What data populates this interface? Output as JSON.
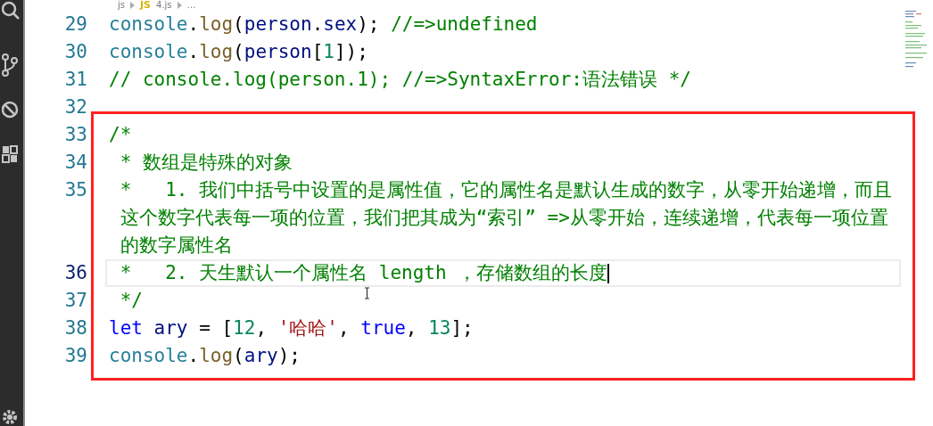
{
  "breadcrumb": {
    "folder": "js",
    "file_badge": "JS",
    "file": "4.js",
    "more": "…"
  },
  "lines": [
    {
      "number": "29",
      "current": false,
      "tokens": [
        {
          "kind": "obj",
          "text": "console"
        },
        {
          "kind": "plain",
          "text": "."
        },
        {
          "kind": "fn",
          "text": "log"
        },
        {
          "kind": "plain",
          "text": "("
        },
        {
          "kind": "var",
          "text": "person"
        },
        {
          "kind": "plain",
          "text": "."
        },
        {
          "kind": "var",
          "text": "sex"
        },
        {
          "kind": "plain",
          "text": "); "
        },
        {
          "kind": "comment",
          "text": "//=>undefined"
        }
      ]
    },
    {
      "number": "30",
      "current": false,
      "tokens": [
        {
          "kind": "obj",
          "text": "console"
        },
        {
          "kind": "plain",
          "text": "."
        },
        {
          "kind": "fn",
          "text": "log"
        },
        {
          "kind": "plain",
          "text": "("
        },
        {
          "kind": "var",
          "text": "person"
        },
        {
          "kind": "plain",
          "text": "["
        },
        {
          "kind": "num",
          "text": "1"
        },
        {
          "kind": "plain",
          "text": "]);"
        }
      ]
    },
    {
      "number": "31",
      "current": false,
      "tokens": [
        {
          "kind": "comment",
          "text": "// console.log(person.1); //=>SyntaxError:语法错误 */"
        }
      ]
    },
    {
      "number": "32",
      "current": false
    }
  ],
  "annotation": {
    "color": "#ff2020",
    "lines": [
      {
        "number": "33",
        "current": false,
        "tokens": [
          {
            "kind": "comment",
            "text": "/*"
          }
        ]
      },
      {
        "number": "34",
        "current": false,
        "tokens": [
          {
            "kind": "comment",
            "text": " * 数组是特殊的对象"
          }
        ]
      },
      {
        "number": "35",
        "current": false,
        "tokens": [
          {
            "kind": "comment",
            "text": " *   1. 我们中括号中设置的是属性值，它的属性名是默认生成的数字，从零开始递增，而且这个数字代表每一项的位置，我们把其成为“索引” =>从零开始，连续递增，代表每一项位置的数字属性名"
          }
        ]
      },
      {
        "number": "36",
        "current": true,
        "caret": true,
        "tokens": [
          {
            "kind": "comment",
            "text": " *   2. 天生默认一个属性名 length ，存储数组的长度"
          }
        ]
      },
      {
        "number": "37",
        "current": false,
        "tokens": [
          {
            "kind": "comment",
            "text": " */"
          }
        ]
      },
      {
        "number": "38",
        "current": false,
        "tokens": [
          {
            "kind": "kw",
            "text": "let"
          },
          {
            "kind": "var",
            "text": " ary"
          },
          {
            "kind": "plain",
            "text": " = ["
          },
          {
            "kind": "num",
            "text": "12"
          },
          {
            "kind": "plain",
            "text": ", "
          },
          {
            "kind": "str",
            "text": "'哈哈'"
          },
          {
            "kind": "plain",
            "text": ", "
          },
          {
            "kind": "kw",
            "text": "true"
          },
          {
            "kind": "plain",
            "text": ", "
          },
          {
            "kind": "num",
            "text": "13"
          },
          {
            "kind": "plain",
            "text": "];"
          }
        ]
      },
      {
        "number": "39",
        "current": false,
        "tokens": [
          {
            "kind": "obj",
            "text": "console"
          },
          {
            "kind": "plain",
            "text": "."
          },
          {
            "kind": "fn",
            "text": "log"
          },
          {
            "kind": "plain",
            "text": "("
          },
          {
            "kind": "var",
            "text": "ary"
          },
          {
            "kind": "plain",
            "text": ");"
          }
        ]
      }
    ]
  }
}
